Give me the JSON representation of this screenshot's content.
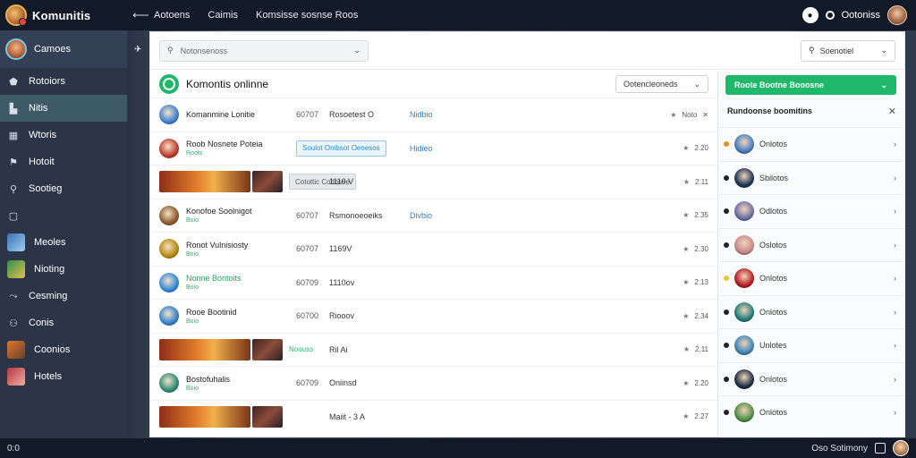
{
  "brand": {
    "name": "Komunitis"
  },
  "topnav": {
    "items": [
      "Aotoens",
      "Caimis",
      "Komsisse sosnse Roos"
    ]
  },
  "topright": {
    "status_label": "O",
    "user_label": "Ootoniss"
  },
  "sidebar": {
    "header": "Camoes",
    "items": [
      {
        "label": "Rotoiors",
        "icon": "shield-icon",
        "active": false
      },
      {
        "label": "Nitis",
        "icon": "book-icon",
        "active": true
      },
      {
        "label": "Wtoris",
        "icon": "grid-icon",
        "active": false
      },
      {
        "label": "Hotoit",
        "icon": "flag-icon",
        "active": false
      },
      {
        "label": "Sootieg",
        "icon": "search-user-icon",
        "active": false
      },
      {
        "label": "",
        "icon": "square-icon",
        "active": false
      },
      {
        "label": "Meoles",
        "icon": "thumb-blue",
        "active": false
      },
      {
        "label": "Nioting",
        "icon": "thumb-green",
        "active": false
      },
      {
        "label": "Cesming",
        "icon": "share-icon",
        "active": false
      },
      {
        "label": "Conis",
        "icon": "people-icon",
        "active": false
      },
      {
        "label": "Coonios",
        "icon": "thumb-orange",
        "active": false
      },
      {
        "label": "Hotels",
        "icon": "thumb-red",
        "active": false
      }
    ]
  },
  "toolbar": {
    "search_placeholder": "Notonsenoss",
    "sort_label": "Soenotiel"
  },
  "list": {
    "title": "Komontis onlinne",
    "filter_label": "Ootencleoneds",
    "rows": [
      {
        "title": "Komanmine  Lonitie",
        "sub": "",
        "num": "60707",
        "tag": "Rosoetest  O",
        "link": "Nidbio",
        "right": "Noto",
        "kind": "icon",
        "icon_color": "#3b7fd4",
        "x": true
      },
      {
        "title": "Roob Nosnete Poteia",
        "sub": "Roots",
        "num": "",
        "tag": "",
        "link": "Hidieo",
        "right": "2.20",
        "kind": "chip",
        "chip": "Soulot Onibsot  Oeoesos",
        "icon_color": "#c0392b"
      },
      {
        "title": "",
        "sub": "",
        "num": "",
        "tag": "1110  V",
        "link": "",
        "right": "2.11",
        "kind": "banner",
        "chip": "Cotottic Coltosee"
      },
      {
        "title": "Konofoe Soolnigot",
        "sub": "Boio",
        "num": "60707",
        "tag": "Rsmonoeoeiks",
        "link": "Divbio",
        "right": "2.35",
        "kind": "icon",
        "icon_color": "#8a5a2b"
      },
      {
        "title": "Ronot  Vulnisiosty",
        "sub": "Boio",
        "num": "60707",
        "tag": "1169V",
        "link": "",
        "right": "2.30",
        "kind": "icon",
        "icon_color": "#b8860b"
      },
      {
        "title": "Nonne  Bontoits",
        "sub": "Boio",
        "num": "60709",
        "tag": "1110ov",
        "link": "",
        "right": "2.13",
        "kind": "icon",
        "icon_color": "#2e86de",
        "title_green": true
      },
      {
        "title": "Rooe  Bootinid",
        "sub": "Boio",
        "num": "60700",
        "tag": "Riooov",
        "link": "",
        "right": "2.34",
        "kind": "icon",
        "icon_color": "#2f7fd0"
      },
      {
        "title": "",
        "sub": "",
        "num": "",
        "tag": "Ril  Ai",
        "link": "",
        "right": "2.11",
        "kind": "banner2",
        "chip": "Noouss"
      },
      {
        "title": "Bostofuhalis",
        "sub": "Boio",
        "num": "60709",
        "tag": "Oniinsd",
        "link": "",
        "right": "2.20",
        "kind": "icon",
        "icon_color": "#2c8a74"
      },
      {
        "title": "",
        "sub": "",
        "num": "",
        "tag": "Maiit -  3  A",
        "link": "",
        "right": "2.27",
        "kind": "banner3"
      }
    ]
  },
  "rightpanel": {
    "button_label": "Roote Bootne Booosne",
    "header": "Rundoonse boomitins",
    "items": [
      {
        "label": "Onlotos",
        "status": "#f28c28",
        "avatar": "#4a7fc1"
      },
      {
        "label": "Sbilotos",
        "status": "#222222",
        "avatar": "#1d3557"
      },
      {
        "label": "Odlotos",
        "status": "#222222",
        "avatar": "#6b6fa8"
      },
      {
        "label": "Oslotos",
        "status": "#222222",
        "avatar": "#c98a8a"
      },
      {
        "label": "Onlotos",
        "status": "#f2c12e",
        "avatar": "#b81d24"
      },
      {
        "label": "Onlotos",
        "status": "#222222",
        "avatar": "#1f7d7a"
      },
      {
        "label": "Unlotes",
        "status": "#222222",
        "avatar": "#3f86b8"
      },
      {
        "label": "Onlotos",
        "status": "#222222",
        "avatar": "#1b2f45"
      },
      {
        "label": "Onlotos",
        "status": "#222222",
        "avatar": "#4f8f4a"
      }
    ]
  },
  "bottombar": {
    "left": "0:0",
    "right_label": "Oso  Sotimony"
  }
}
